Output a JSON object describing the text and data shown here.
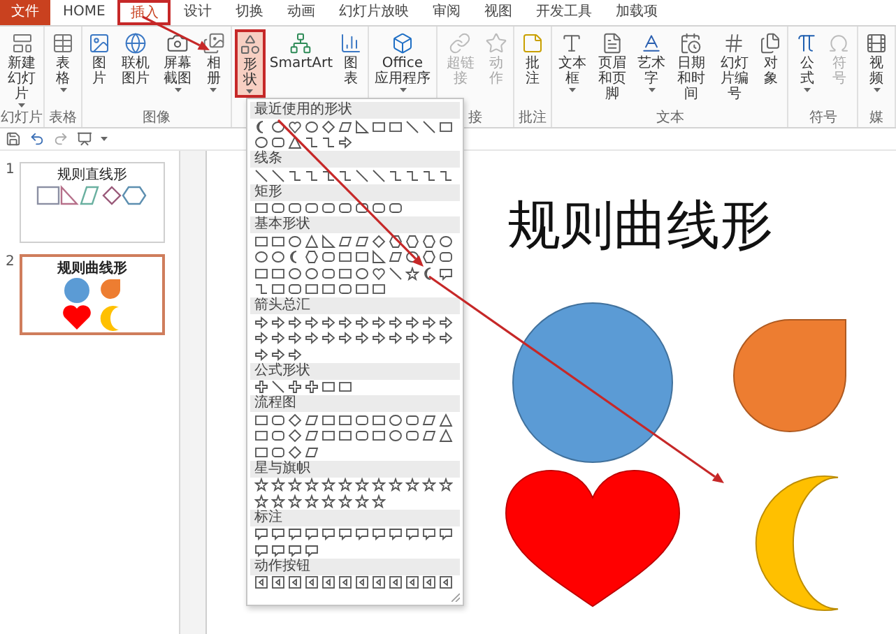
{
  "tabs": [
    {
      "label": "文件",
      "kind": "file",
      "selected": false,
      "annotated": false
    },
    {
      "label": "HOME",
      "kind": "tab",
      "selected": false,
      "annotated": false
    },
    {
      "label": "插入",
      "kind": "tab",
      "selected": true,
      "annotated": true
    },
    {
      "label": "设计",
      "kind": "tab",
      "selected": false,
      "annotated": false
    },
    {
      "label": "切换",
      "kind": "tab",
      "selected": false,
      "annotated": false
    },
    {
      "label": "动画",
      "kind": "tab",
      "selected": false,
      "annotated": false
    },
    {
      "label": "幻灯片放映",
      "kind": "tab",
      "selected": false,
      "annotated": false
    },
    {
      "label": "审阅",
      "kind": "tab",
      "selected": false,
      "annotated": false
    },
    {
      "label": "视图",
      "kind": "tab",
      "selected": false,
      "annotated": false
    },
    {
      "label": "开发工具",
      "kind": "tab",
      "selected": false,
      "annotated": false
    },
    {
      "label": "加载项",
      "kind": "tab",
      "selected": false,
      "annotated": false
    }
  ],
  "ribbon": [
    {
      "label": "幻灯片",
      "buttons": [
        {
          "label": "新建幻灯片",
          "dropdown": true,
          "disabled": false,
          "annotated": false
        }
      ]
    },
    {
      "label": "表格",
      "buttons": [
        {
          "label": "表格",
          "dropdown": true,
          "disabled": false,
          "annotated": false
        }
      ]
    },
    {
      "label": "图像",
      "buttons": [
        {
          "label": "图片",
          "dropdown": false,
          "disabled": false,
          "annotated": false
        },
        {
          "label": "联机图片",
          "dropdown": false,
          "disabled": false,
          "annotated": false
        },
        {
          "label": "屏幕截图",
          "dropdown": true,
          "disabled": false,
          "annotated": false
        },
        {
          "label": "相册",
          "dropdown": true,
          "disabled": false,
          "annotated": false
        }
      ]
    },
    {
      "buttons": [
        {
          "label": "形状",
          "dropdown": true,
          "disabled": false,
          "annotated": true
        },
        {
          "label": "SmartArt",
          "dropdown": false,
          "disabled": false,
          "annotated": false
        },
        {
          "label": "图表",
          "dropdown": false,
          "disabled": false,
          "annotated": false
        }
      ]
    },
    {
      "buttons": [
        {
          "label": "Office\n应用程序",
          "dropdown": true,
          "disabled": false,
          "annotated": false
        }
      ]
    },
    {
      "label": "接",
      "buttons": [
        {
          "label": "超链接",
          "dropdown": false,
          "disabled": true,
          "annotated": false
        },
        {
          "label": "动作",
          "dropdown": false,
          "disabled": true,
          "annotated": false
        }
      ]
    },
    {
      "label": "批注",
      "buttons": [
        {
          "label": "批注",
          "dropdown": false,
          "disabled": false,
          "annotated": false
        }
      ]
    },
    {
      "label": "文本",
      "buttons": [
        {
          "label": "文本框",
          "dropdown": true,
          "disabled": false,
          "annotated": false
        },
        {
          "label": "页眉和页脚",
          "dropdown": false,
          "disabled": false,
          "annotated": false
        },
        {
          "label": "艺术字",
          "dropdown": true,
          "disabled": false,
          "annotated": false
        },
        {
          "label": "日期和时间",
          "dropdown": false,
          "disabled": false,
          "annotated": false
        },
        {
          "label": "幻灯片编号",
          "dropdown": false,
          "disabled": false,
          "annotated": false
        },
        {
          "label": "对象",
          "dropdown": false,
          "disabled": false,
          "annotated": false
        }
      ]
    },
    {
      "label": "符号",
      "buttons": [
        {
          "label": "公式",
          "dropdown": true,
          "disabled": false,
          "annotated": false
        },
        {
          "label": "符号",
          "dropdown": false,
          "disabled": true,
          "annotated": false
        }
      ]
    },
    {
      "label": "媒",
      "buttons": [
        {
          "label": "视频",
          "dropdown": true,
          "disabled": false,
          "annotated": false
        }
      ]
    }
  ],
  "shapes_gallery": {
    "sections": [
      {
        "title": "最近使用的形状"
      },
      {
        "title": "线条"
      },
      {
        "title": "矩形"
      },
      {
        "title": "基本形状"
      },
      {
        "title": "箭头总汇"
      },
      {
        "title": "公式形状"
      },
      {
        "title": "流程图"
      },
      {
        "title": "星与旗帜"
      },
      {
        "title": "标注"
      },
      {
        "title": "动作按钮"
      }
    ]
  },
  "slides": [
    {
      "number": "1",
      "title": "规则直线形",
      "kind": "straight",
      "selected": false
    },
    {
      "number": "2",
      "title": "规则曲线形",
      "kind": "curved",
      "selected": true
    }
  ],
  "main_slide": {
    "title": "规则曲线形"
  }
}
